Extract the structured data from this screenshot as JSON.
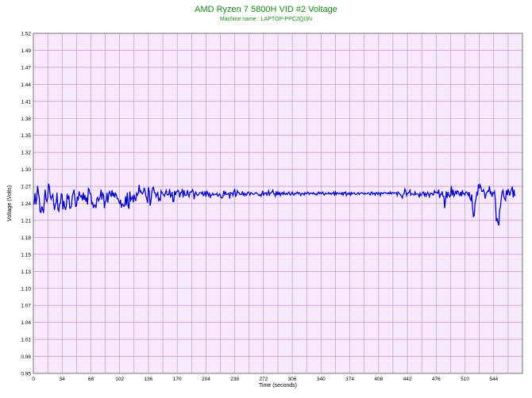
{
  "chart_data": {
    "type": "line",
    "title": "AMD Ryzen 7 5800H VID #2 Voltage",
    "subtitle": "Machine name : LAPTOP-PPC2QI3N",
    "xlabel": "Time (seconds)",
    "ylabel": "Voltage (Volts)",
    "xlim": [
      0,
      578
    ],
    "ylim": [
      0.95,
      1.52
    ],
    "x_ticks": [
      0,
      34,
      68,
      102,
      136,
      170,
      204,
      238,
      272,
      306,
      340,
      374,
      408,
      442,
      476,
      510,
      544
    ],
    "y_ticks": [
      0.95,
      0.98,
      1.01,
      1.04,
      1.07,
      1.1,
      1.13,
      1.15,
      1.18,
      1.21,
      1.24,
      1.27,
      1.3,
      1.32,
      1.35,
      1.38,
      1.41,
      1.44,
      1.47,
      1.49,
      1.52
    ],
    "grid": true,
    "colors": {
      "line": "#0000cc",
      "plot_bg": "#f7e8fb",
      "grid": "#b98fc4",
      "title": "#1a8c1a"
    },
    "series": [
      {
        "values_x": [
          0,
          1,
          2,
          3,
          4,
          5,
          6,
          7,
          8,
          9,
          10,
          11,
          12,
          13,
          14,
          15,
          16,
          17,
          18,
          19,
          20,
          21,
          22,
          23,
          24,
          25,
          26,
          27,
          28,
          29,
          30,
          31,
          32,
          33,
          34,
          35,
          36,
          37,
          38,
          39,
          40,
          41,
          42,
          43,
          44,
          45,
          46,
          47,
          48,
          49,
          50,
          51,
          52,
          53,
          54,
          55,
          56,
          57,
          58,
          59,
          60,
          61,
          62,
          63,
          64,
          65,
          66,
          67,
          68,
          69,
          70,
          71,
          72,
          73,
          74,
          75,
          76,
          77,
          78,
          79,
          80,
          81,
          82,
          83,
          84,
          85,
          86,
          87,
          88,
          89,
          90,
          91,
          92,
          93,
          94,
          95,
          96,
          97,
          98,
          99,
          100,
          101,
          102,
          103,
          104,
          105,
          106,
          107,
          108,
          109,
          110,
          111,
          112,
          113,
          114,
          115,
          116,
          117,
          118,
          119,
          120,
          121,
          122,
          123,
          124,
          125,
          126,
          127,
          128,
          129,
          130,
          131,
          132,
          133,
          134,
          135,
          136,
          137,
          138,
          139,
          140,
          141,
          142,
          143,
          144,
          145,
          146,
          147,
          148,
          149,
          150,
          151,
          152,
          153,
          154,
          155,
          156,
          157,
          158,
          159,
          160,
          161,
          162,
          163,
          164,
          165,
          166,
          167,
          168,
          169,
          170,
          171,
          172,
          173,
          174,
          175,
          176,
          177,
          178,
          179,
          180,
          181,
          182,
          183,
          184,
          185,
          186,
          187,
          188,
          189,
          190,
          191,
          192,
          193,
          194,
          195,
          196,
          197,
          198,
          199,
          200,
          201,
          202,
          203,
          204,
          205,
          206,
          207,
          208,
          209,
          210,
          211,
          212,
          213,
          214,
          215,
          216,
          217,
          218,
          219,
          220,
          221,
          222,
          223,
          224,
          225,
          226,
          227,
          228,
          229,
          230,
          231,
          232,
          233,
          234,
          235,
          236,
          237,
          238,
          239,
          240,
          241,
          242,
          243,
          244,
          245,
          246,
          247,
          248,
          249,
          250,
          251,
          252,
          253,
          254,
          255,
          256,
          257,
          258,
          259,
          260,
          261,
          262,
          263,
          264,
          265,
          266,
          267,
          268,
          269,
          270,
          271,
          272,
          273,
          274,
          275,
          276,
          277,
          278,
          279,
          280,
          281,
          282,
          283,
          284,
          285,
          286,
          287,
          288,
          289,
          290,
          291,
          292,
          293,
          294,
          295,
          296,
          297,
          298,
          299,
          300,
          301,
          302,
          303,
          304,
          305,
          306,
          307,
          308,
          309,
          310,
          311,
          312,
          313,
          314,
          315,
          316,
          317,
          318,
          319,
          320,
          321,
          322,
          323,
          324,
          325,
          326,
          327,
          328,
          329,
          330,
          331,
          332,
          333,
          334,
          335,
          336,
          337,
          338,
          339,
          340,
          341,
          342,
          343,
          344,
          345,
          346,
          347,
          348,
          349,
          350,
          351,
          352,
          353,
          354,
          355,
          356,
          357,
          358,
          359,
          360,
          361,
          362,
          363,
          364,
          365,
          366,
          367,
          368,
          369,
          370,
          371,
          372,
          373,
          374,
          375,
          376,
          377,
          378,
          379,
          380,
          381,
          382,
          383,
          384,
          385,
          386,
          387,
          388,
          389,
          390,
          391,
          392,
          393,
          394,
          395,
          396,
          397,
          398,
          399,
          400,
          401,
          402,
          403,
          404,
          405,
          406,
          407,
          408,
          409,
          410,
          411,
          412,
          413,
          414,
          415,
          416,
          417,
          418,
          419,
          420,
          421,
          422,
          423,
          424,
          425,
          426,
          427,
          428,
          429,
          430,
          431,
          432,
          433,
          434,
          435,
          436,
          437,
          438,
          439,
          440,
          441,
          442,
          443,
          444,
          445,
          446,
          447,
          448,
          449,
          450,
          451,
          452,
          453,
          454,
          455,
          456,
          457,
          458,
          459,
          460,
          461,
          462,
          463,
          464,
          465,
          466,
          467,
          468,
          469,
          470,
          471,
          472,
          473,
          474,
          475,
          476,
          477,
          478,
          479,
          480,
          481,
          482,
          483,
          484,
          485,
          486,
          487,
          488,
          489,
          490,
          491,
          492,
          493,
          494,
          495,
          496,
          497,
          498,
          499,
          500,
          501,
          502,
          503,
          504,
          505,
          506,
          507,
          508,
          509,
          510,
          511,
          512,
          513,
          514,
          515,
          516,
          517,
          518,
          519,
          520,
          521,
          522,
          523,
          524,
          525,
          526,
          527,
          528,
          529,
          530,
          531,
          532,
          533,
          534,
          535,
          536,
          537,
          538,
          539,
          540,
          541,
          542,
          543,
          544,
          545,
          546,
          547,
          548,
          549,
          550,
          551,
          552,
          553,
          554,
          555,
          556,
          557,
          558,
          559,
          560,
          561,
          562,
          563,
          564,
          565,
          566,
          567,
          568,
          569,
          570,
          571,
          572,
          573,
          574,
          575,
          576,
          577,
          578
        ],
        "values_y": [
          1.233,
          1.235,
          1.252,
          1.233,
          1.243,
          1.264,
          1.253,
          1.243,
          1.221,
          1.22,
          1.23,
          1.225,
          1.219,
          1.241,
          1.258,
          1.242,
          1.238,
          1.244,
          1.268,
          1.263,
          1.247,
          1.242,
          1.247,
          1.25,
          1.235,
          1.224,
          1.233,
          1.236,
          1.253,
          1.225,
          1.222,
          1.234,
          1.235,
          1.251,
          1.25,
          1.225,
          1.239,
          1.23,
          1.224,
          1.231,
          1.251,
          1.242,
          1.248,
          1.227,
          1.227,
          1.231,
          1.247,
          1.252,
          1.258,
          1.244,
          1.23,
          1.231,
          1.246,
          1.24,
          1.255,
          1.249,
          1.246,
          1.248,
          1.24,
          1.253,
          1.241,
          1.249,
          1.238,
          1.245,
          1.233,
          1.26,
          1.258,
          1.251,
          1.251,
          1.233,
          1.237,
          1.227,
          1.232,
          1.232,
          1.227,
          1.242,
          1.245,
          1.239,
          1.242,
          1.247,
          1.258,
          1.241,
          1.252,
          1.249,
          1.227,
          1.238,
          1.239,
          1.253,
          1.236,
          1.25,
          1.255,
          1.251,
          1.246,
          1.257,
          1.247,
          1.253,
          1.245,
          1.252,
          1.25,
          1.243,
          1.243,
          1.239,
          1.234,
          1.241,
          1.228,
          1.234,
          1.233,
          1.23,
          1.231,
          1.247,
          1.232,
          1.253,
          1.23,
          1.226,
          1.255,
          1.24,
          1.243,
          1.246,
          1.237,
          1.25,
          1.243,
          1.239,
          1.252,
          1.249,
          1.252,
          1.266,
          1.254,
          1.256,
          1.252,
          1.251,
          1.254,
          1.261,
          1.256,
          1.247,
          1.243,
          1.236,
          1.262,
          1.255,
          1.231,
          1.239,
          1.254,
          1.261,
          1.262,
          1.253,
          1.253,
          1.246,
          1.25,
          1.253,
          1.24,
          1.243,
          1.239,
          1.256,
          1.253,
          1.251,
          1.249,
          1.247,
          1.253,
          1.257,
          1.25,
          1.249,
          1.25,
          1.259,
          1.246,
          1.248,
          1.254,
          1.238,
          1.238,
          1.256,
          1.249,
          1.254,
          1.255,
          1.257,
          1.254,
          1.245,
          1.253,
          1.253,
          1.259,
          1.245,
          1.257,
          1.249,
          1.248,
          1.249,
          1.257,
          1.25,
          1.246,
          1.254,
          1.254,
          1.254,
          1.258,
          1.255,
          1.242,
          1.251,
          1.254,
          1.25,
          1.248,
          1.249,
          1.252,
          1.253,
          1.253,
          1.251,
          1.254,
          1.248,
          1.25,
          1.255,
          1.246,
          1.255,
          1.253,
          1.248,
          1.253,
          1.244,
          1.249,
          1.249,
          1.252,
          1.249,
          1.25,
          1.25,
          1.25,
          1.252,
          1.247,
          1.248,
          1.251,
          1.249,
          1.244,
          1.244,
          1.246,
          1.256,
          1.25,
          1.254,
          1.25,
          1.25,
          1.251,
          1.252,
          1.243,
          1.253,
          1.252,
          1.252,
          1.248,
          1.256,
          1.258,
          1.247,
          1.249,
          1.256,
          1.253,
          1.253,
          1.25,
          1.25,
          1.25,
          1.255,
          1.249,
          1.252,
          1.248,
          1.251,
          1.249,
          1.253,
          1.254,
          1.252,
          1.249,
          1.253,
          1.252,
          1.251,
          1.25,
          1.251,
          1.252,
          1.253,
          1.252,
          1.251,
          1.249,
          1.248,
          1.25,
          1.247,
          1.251,
          1.256,
          1.248,
          1.252,
          1.252,
          1.253,
          1.249,
          1.252,
          1.256,
          1.249,
          1.252,
          1.253,
          1.254,
          1.257,
          1.251,
          1.251,
          1.247,
          1.255,
          1.249,
          1.254,
          1.25,
          1.253,
          1.248,
          1.252,
          1.253,
          1.25,
          1.254,
          1.25,
          1.25,
          1.252,
          1.25,
          1.252,
          1.254,
          1.25,
          1.249,
          1.252,
          1.254,
          1.25,
          1.249,
          1.252,
          1.251,
          1.252,
          1.254,
          1.251,
          1.253,
          1.252,
          1.248,
          1.251,
          1.252,
          1.251,
          1.249,
          1.253,
          1.251,
          1.251,
          1.254,
          1.253,
          1.25,
          1.252,
          1.252,
          1.252,
          1.251,
          1.253,
          1.251,
          1.25,
          1.251,
          1.249,
          1.252,
          1.254,
          1.251,
          1.253,
          1.251,
          1.252,
          1.254,
          1.25,
          1.249,
          1.252,
          1.252,
          1.251,
          1.251,
          1.253,
          1.251,
          1.252,
          1.25,
          1.252,
          1.252,
          1.254,
          1.248,
          1.254,
          1.25,
          1.253,
          1.252,
          1.251,
          1.252,
          1.252,
          1.25,
          1.253,
          1.249,
          1.253,
          1.252,
          1.254,
          1.248,
          1.251,
          1.252,
          1.25,
          1.253,
          1.249,
          1.253,
          1.251,
          1.252,
          1.253,
          1.251,
          1.25,
          1.25,
          1.252,
          1.253,
          1.25,
          1.252,
          1.252,
          1.253,
          1.252,
          1.252,
          1.25,
          1.252,
          1.251,
          1.251,
          1.252,
          1.253,
          1.251,
          1.249,
          1.253,
          1.254,
          1.25,
          1.252,
          1.252,
          1.249,
          1.253,
          1.253,
          1.25,
          1.253,
          1.252,
          1.248,
          1.253,
          1.252,
          1.251,
          1.253,
          1.253,
          1.253,
          1.252,
          1.252,
          1.251,
          1.253,
          1.251,
          1.254,
          1.251,
          1.253,
          1.253,
          1.252,
          1.253,
          1.252,
          1.253,
          1.248,
          1.254,
          1.252,
          1.251,
          1.249,
          1.247,
          1.244,
          1.25,
          1.251,
          1.259,
          1.256,
          1.248,
          1.252,
          1.252,
          1.254,
          1.257,
          1.249,
          1.251,
          1.251,
          1.25,
          1.249,
          1.254,
          1.25,
          1.251,
          1.251,
          1.25,
          1.245,
          1.252,
          1.248,
          1.25,
          1.253,
          1.254,
          1.248,
          1.252,
          1.247,
          1.251,
          1.254,
          1.25,
          1.246,
          1.252,
          1.251,
          1.252,
          1.249,
          1.25,
          1.256,
          1.253,
          1.254,
          1.253,
          1.252,
          1.258,
          1.244,
          1.25,
          1.25,
          1.255,
          1.247,
          1.247,
          1.227,
          1.24,
          1.255,
          1.244,
          1.254,
          1.249,
          1.246,
          1.248,
          1.264,
          1.248,
          1.258,
          1.247,
          1.25,
          1.256,
          1.25,
          1.256,
          1.255,
          1.25,
          1.248,
          1.254,
          1.247,
          1.257,
          1.251,
          1.251,
          1.249,
          1.254,
          1.254,
          1.252,
          1.248,
          1.254,
          1.243,
          1.24,
          1.25,
          1.228,
          1.213,
          1.215,
          1.236,
          1.242,
          1.253,
          1.25,
          1.267,
          1.26,
          1.266,
          1.261,
          1.255,
          1.255,
          1.258,
          1.253,
          1.243,
          1.251,
          1.253,
          1.256,
          1.255,
          1.264,
          1.252,
          1.254,
          1.246,
          1.253,
          1.252,
          1.255,
          1.24,
          1.205,
          1.21,
          1.203,
          1.198,
          1.223,
          1.23,
          1.244,
          1.254,
          1.257,
          1.246,
          1.242,
          1.24,
          1.257,
          1.249,
          1.259,
          1.254,
          1.248,
          1.255,
          1.258,
          1.263,
          1.245,
          1.258,
          1.247
        ]
      }
    ]
  }
}
